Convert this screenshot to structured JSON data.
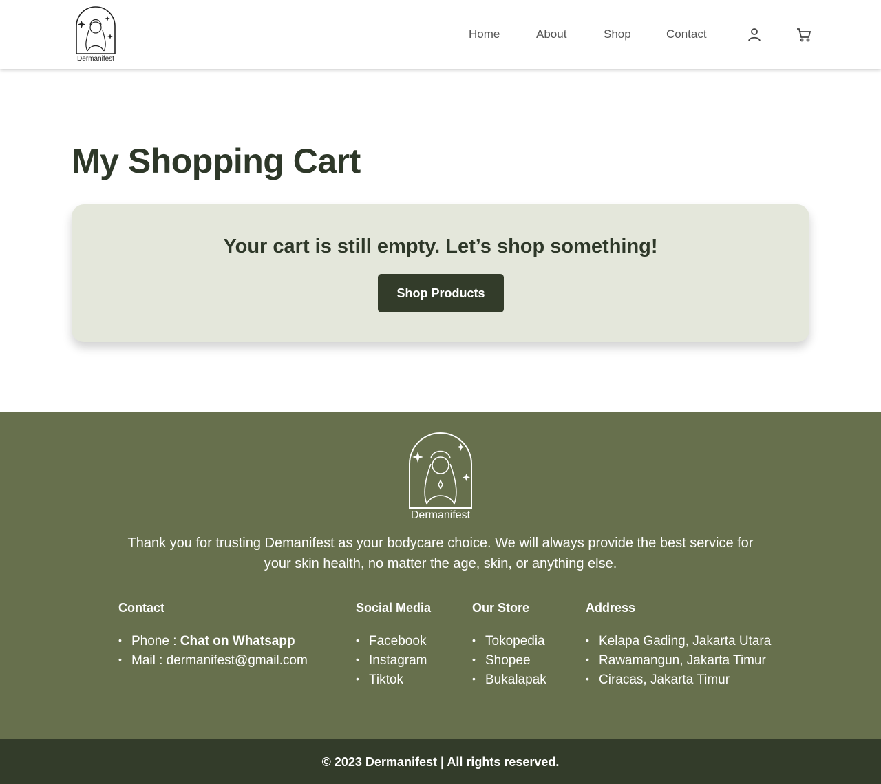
{
  "brand": {
    "name": "Dermanifest",
    "accent": "#333c2a",
    "footer_bg": "#67704d",
    "card_bg": "#e4e7db"
  },
  "nav": {
    "links": [
      "Home",
      "About",
      "Shop",
      "Contact"
    ],
    "icons": [
      "user-icon",
      "cart-icon"
    ]
  },
  "page": {
    "title": "My Shopping Cart"
  },
  "cart": {
    "empty_message": "Your cart is still empty. Let’s shop something!",
    "button_label": "Shop Products"
  },
  "footer": {
    "logo_text": "Dermanifest",
    "tagline": "Thank you for trusting Demanifest as your bodycare choice. We will always provide the best service for your skin health, no matter the age, skin, or anything else.",
    "contact": {
      "heading": "Contact",
      "phone_label": "Phone : ",
      "phone_link": "Chat on Whatsapp",
      "mail": "Mail : dermanifest@gmail.com"
    },
    "social": {
      "heading": "Social Media",
      "items": [
        "Facebook",
        "Instagram",
        "Tiktok"
      ]
    },
    "store": {
      "heading": "Our Store",
      "items": [
        "Tokopedia",
        "Shopee",
        "Bukalapak"
      ]
    },
    "address": {
      "heading": "Address",
      "items": [
        "Kelapa Gading, Jakarta Utara",
        "Rawamangun, Jakarta Timur",
        "Ciracas, Jakarta Timur"
      ]
    }
  },
  "copyright": "© 2023 Dermanifest | All rights reserved."
}
